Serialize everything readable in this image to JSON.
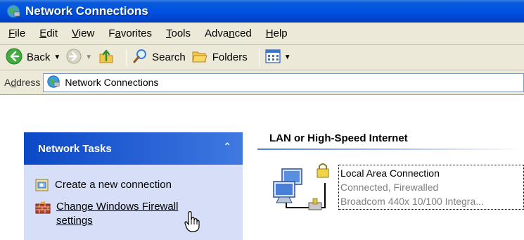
{
  "window": {
    "title": "Network Connections"
  },
  "menu": {
    "items": [
      {
        "label": "File",
        "mnemonic": "F",
        "rest": "ile"
      },
      {
        "label": "Edit",
        "mnemonic": "E",
        "rest": "dit"
      },
      {
        "label": "View",
        "mnemonic": "V",
        "rest": "iew"
      },
      {
        "label": "Favorites",
        "pre": "F",
        "mnemonic": "a",
        "rest": "vorites"
      },
      {
        "label": "Tools",
        "mnemonic": "T",
        "rest": "ools"
      },
      {
        "label": "Advanced",
        "pre": "Adva",
        "mnemonic": "n",
        "rest": "ced"
      },
      {
        "label": "Help",
        "mnemonic": "H",
        "rest": "elp"
      }
    ]
  },
  "toolbar": {
    "back_label": "Back",
    "search_label": "Search",
    "folders_label": "Folders"
  },
  "address": {
    "label_pre": "A",
    "label_mnemonic": "d",
    "label_rest": "dress",
    "value": "Network Connections"
  },
  "tasks": {
    "header": "Network Tasks",
    "collapse_glyph": "⌃",
    "items": [
      {
        "label": "Create a new connection"
      },
      {
        "label_line1": "Change Windows Firewall",
        "label_line2": "settings"
      }
    ]
  },
  "section": {
    "title": "LAN or High-Speed Internet"
  },
  "connection": {
    "name": "Local Area Connection",
    "status": "Connected, Firewalled",
    "device": "Broadcom 440x 10/100 Integra..."
  },
  "icons": {
    "app": "network-connections-icon",
    "back": "back-arrow-icon",
    "forward": "forward-arrow-icon",
    "up": "up-folder-icon",
    "search": "search-magnifier-icon",
    "folders": "folders-icon",
    "views": "views-icon",
    "address_page": "network-connections-icon",
    "create": "new-connection-icon",
    "firewall": "firewall-icon",
    "lan": "lan-connection-icon",
    "lock": "padlock-icon",
    "cursor": "hand-cursor-icon"
  },
  "colors": {
    "titlebar": "#0053e2",
    "chrome": "#ece9d8",
    "task_header": "#0a48c6",
    "task_panel": "#d6dff7"
  }
}
